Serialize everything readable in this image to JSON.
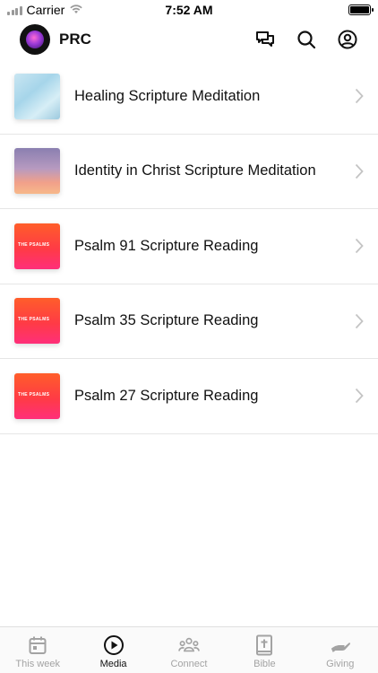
{
  "status_bar": {
    "carrier": "Carrier",
    "time": "7:52 AM"
  },
  "header": {
    "app_title": "PRC"
  },
  "media_items": [
    {
      "title": "Healing Scripture Meditation",
      "thumb": "sky-clouds",
      "thumb_text": ""
    },
    {
      "title": "Identity in Christ Scripture Meditation",
      "thumb": "sunset-sky",
      "thumb_text": ""
    },
    {
      "title": "Psalm 91 Scripture Reading",
      "thumb": "psalms-gradient",
      "thumb_text": "THE PSALMS"
    },
    {
      "title": "Psalm 35 Scripture Reading",
      "thumb": "psalms-gradient",
      "thumb_text": "THE PSALMS"
    },
    {
      "title": "Psalm 27 Scripture Reading",
      "thumb": "psalms-gradient",
      "thumb_text": "THE PSALMS"
    }
  ],
  "tabs": [
    {
      "label": "This week",
      "icon": "calendar-icon",
      "active": false
    },
    {
      "label": "Media",
      "icon": "play-circle-icon",
      "active": true
    },
    {
      "label": "Connect",
      "icon": "people-icon",
      "active": false
    },
    {
      "label": "Bible",
      "icon": "bible-icon",
      "active": false
    },
    {
      "label": "Giving",
      "icon": "giving-hand-icon",
      "active": false
    }
  ],
  "colors": {
    "active_tab": "#111111",
    "inactive_tab": "#a3a3a3",
    "divider": "#e6e6e6"
  }
}
